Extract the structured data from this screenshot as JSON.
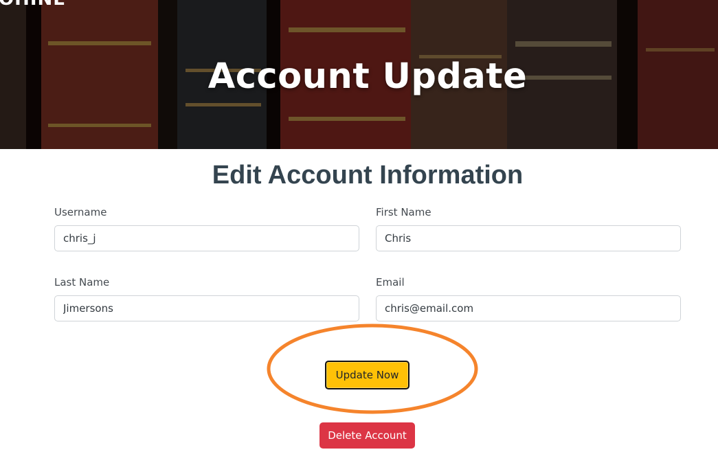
{
  "header": {
    "brand": "OHINE",
    "title": "Account Update"
  },
  "form": {
    "title": "Edit Account Information",
    "fields": {
      "username": {
        "label": "Username",
        "value": "chris_j"
      },
      "first_name": {
        "label": "First Name",
        "value": "Chris"
      },
      "last_name": {
        "label": "Last Name",
        "value": "Jimersons"
      },
      "email": {
        "label": "Email",
        "value": "chris@email.com"
      }
    },
    "update_button": "Update Now",
    "delete_button": "Delete Account"
  },
  "colors": {
    "update_button_bg": "#ffc107",
    "delete_button_bg": "#dc3545",
    "annotation_ring": "#f5842c",
    "title_text": "#34444f"
  }
}
